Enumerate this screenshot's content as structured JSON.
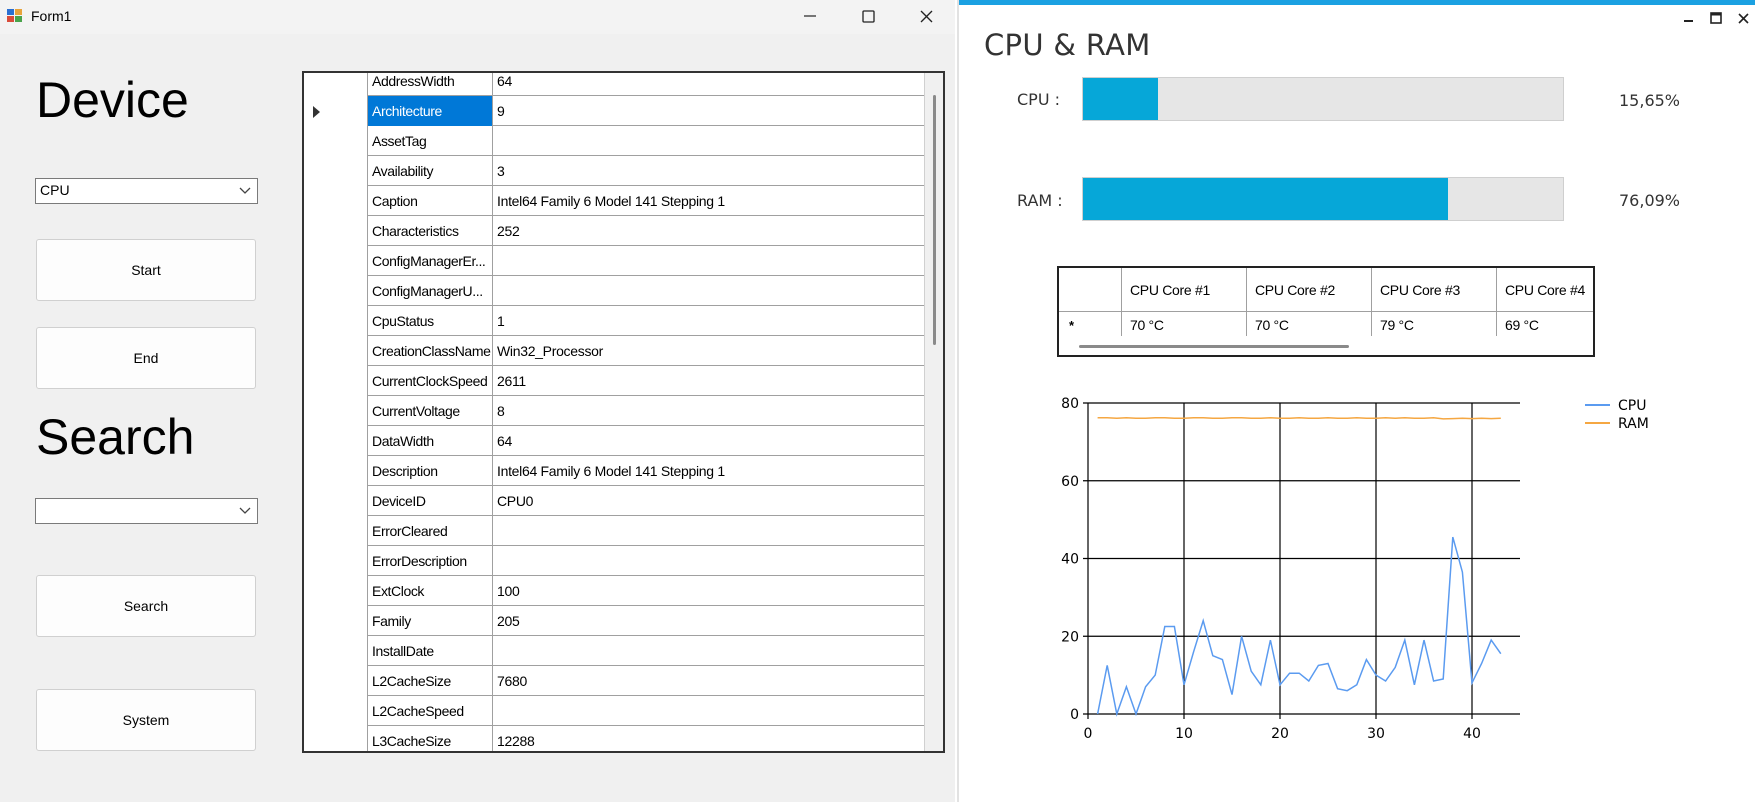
{
  "form1": {
    "title": "Form1",
    "device_heading": "Device",
    "device_combo_value": "CPU",
    "start_label": "Start",
    "end_label": "End",
    "search_heading": "Search",
    "search_combo_value": "",
    "search_label": "Search",
    "system_label": "System",
    "grid_rows": [
      {
        "name": "AddressWidth",
        "value": "64"
      },
      {
        "name": "Architecture",
        "value": "9",
        "selected": true
      },
      {
        "name": "AssetTag",
        "value": ""
      },
      {
        "name": "Availability",
        "value": "3"
      },
      {
        "name": "Caption",
        "value": "Intel64 Family 6 Model 141 Stepping 1"
      },
      {
        "name": "Characteristics",
        "value": "252"
      },
      {
        "name": "ConfigManagerEr...",
        "value": ""
      },
      {
        "name": "ConfigManagerU...",
        "value": ""
      },
      {
        "name": "CpuStatus",
        "value": "1"
      },
      {
        "name": "CreationClassName",
        "value": "Win32_Processor"
      },
      {
        "name": "CurrentClockSpeed",
        "value": "2611"
      },
      {
        "name": "CurrentVoltage",
        "value": "8"
      },
      {
        "name": "DataWidth",
        "value": "64"
      },
      {
        "name": "Description",
        "value": "Intel64 Family 6 Model 141 Stepping 1"
      },
      {
        "name": "DeviceID",
        "value": "CPU0"
      },
      {
        "name": "ErrorCleared",
        "value": ""
      },
      {
        "name": "ErrorDescription",
        "value": ""
      },
      {
        "name": "ExtClock",
        "value": "100"
      },
      {
        "name": "Family",
        "value": "205"
      },
      {
        "name": "InstallDate",
        "value": ""
      },
      {
        "name": "L2CacheSize",
        "value": "7680"
      },
      {
        "name": "L2CacheSpeed",
        "value": ""
      },
      {
        "name": "L3CacheSize",
        "value": "12288"
      }
    ]
  },
  "monitor": {
    "title": "CPU & RAM",
    "cpu_label": "CPU :",
    "cpu_percent_text": "15,65%",
    "cpu_fraction": 0.1565,
    "ram_label": "RAM :",
    "ram_percent_text": "76,09%",
    "ram_fraction": 0.7609,
    "core_headers": [
      "CPU Core #1",
      "CPU Core #2",
      "CPU Core #3",
      "CPU Core #4"
    ],
    "core_values": [
      "70 °C",
      "70 °C",
      "79 °C",
      "69 °C"
    ]
  },
  "colors": {
    "accent": "#1ba1e2",
    "meter_fill": "#06a7d8",
    "selection": "#0078d7",
    "cpu_series": "#5b9bf0",
    "ram_series": "#f5a742"
  },
  "chart_data": {
    "type": "line",
    "xlim": [
      0,
      45
    ],
    "ylim": [
      0,
      80
    ],
    "xticks": [
      0,
      10,
      20,
      30,
      40
    ],
    "yticks": [
      0,
      20,
      40,
      60,
      80
    ],
    "grid": true,
    "legend": "top-right",
    "series": [
      {
        "name": "CPU",
        "color": "#5b9bf0",
        "x": [
          1,
          2,
          3,
          4,
          5,
          6,
          7,
          8,
          9,
          10,
          11,
          12,
          13,
          14,
          15,
          16,
          17,
          18,
          19,
          20,
          21,
          22,
          23,
          24,
          25,
          26,
          27,
          28,
          29,
          30,
          31,
          32,
          33,
          34,
          35,
          36,
          37,
          38,
          39,
          40,
          41,
          42,
          43
        ],
        "y": [
          0,
          12.5,
          0,
          7,
          0,
          7,
          10,
          22.5,
          22.5,
          7.5,
          16,
          24,
          15,
          14,
          5,
          20,
          11,
          7.5,
          19,
          7.5,
          10.5,
          10.5,
          8.5,
          12.5,
          13,
          6.5,
          6,
          7.5,
          14,
          10,
          8.5,
          12,
          19,
          7.5,
          19,
          8.5,
          9,
          45.5,
          36.5,
          8,
          13,
          19,
          15.5
        ]
      },
      {
        "name": "RAM",
        "color": "#f5a742",
        "x": [
          1,
          2,
          3,
          4,
          5,
          6,
          7,
          8,
          9,
          10,
          11,
          12,
          13,
          14,
          15,
          16,
          17,
          18,
          19,
          20,
          21,
          22,
          23,
          24,
          25,
          26,
          27,
          28,
          29,
          30,
          31,
          32,
          33,
          34,
          35,
          36,
          37,
          38,
          39,
          40,
          41,
          42,
          43
        ],
        "y": [
          76.2,
          76.2,
          76.1,
          76.2,
          76.1,
          76.1,
          76.2,
          76.2,
          76.1,
          76.1,
          76.2,
          76.2,
          76.1,
          76.1,
          76.2,
          76.2,
          76.1,
          76.1,
          76.2,
          76.1,
          76.1,
          76.2,
          76.1,
          76.1,
          76.2,
          76.1,
          76.1,
          76.2,
          76.1,
          76.1,
          76.2,
          76.1,
          76.2,
          76.1,
          76.1,
          76.2,
          75.9,
          76.0,
          76.1,
          76.0,
          76.1,
          76.0,
          76.1
        ]
      }
    ]
  }
}
